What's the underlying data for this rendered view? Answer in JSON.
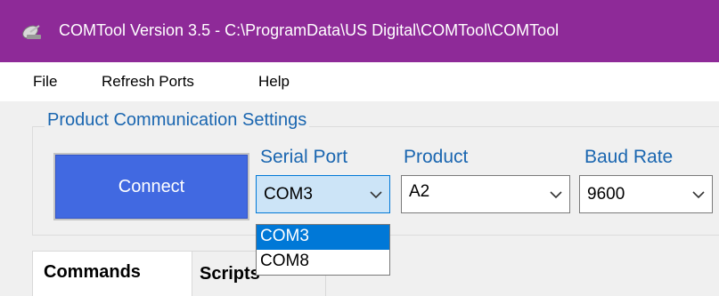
{
  "window": {
    "title": "COMTool Version 3.5 - C:\\ProgramData\\US Digital\\COMTool\\COMTool",
    "icon": "satellite-dish-icon",
    "title_bar_color": "#8e2a98"
  },
  "menu": {
    "items": [
      {
        "label": "File"
      },
      {
        "label": "Refresh Ports"
      },
      {
        "label": "Help"
      }
    ]
  },
  "settings": {
    "group_title": "Product Communication Settings",
    "connect_label": "Connect",
    "connect_color": "#4169e1",
    "serial_port": {
      "label": "Serial Port",
      "value": "COM3",
      "options": [
        "COM3",
        "COM8"
      ],
      "selected_option": "COM3",
      "open": true
    },
    "product": {
      "label": "Product",
      "value": "A2"
    },
    "baud_rate": {
      "label": "Baud Rate",
      "value": "9600"
    },
    "label_color": "#1a66b0",
    "selection_color": "#0078d7"
  },
  "tabs": [
    {
      "label": "Commands",
      "active": true
    },
    {
      "label": "Scripts",
      "active": false
    }
  ]
}
